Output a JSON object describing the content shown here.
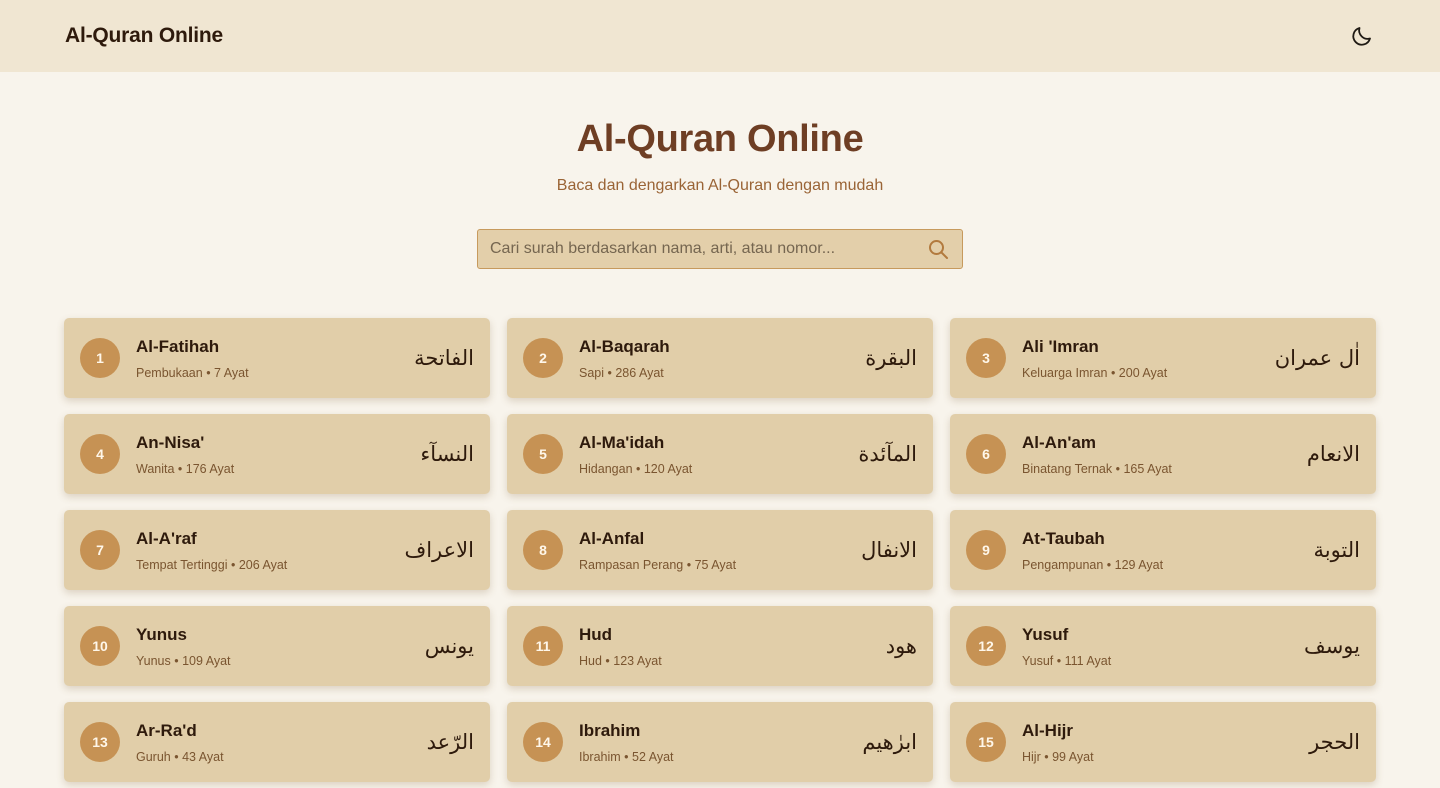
{
  "navbar": {
    "brand": "Al-Quran Online",
    "theme_icon": "moon-icon"
  },
  "hero": {
    "title": "Al-Quran Online",
    "subtitle": "Baca dan dengarkan Al-Quran dengan mudah"
  },
  "search": {
    "placeholder": "Cari surah berdasarkan nama, arti, atau nomor...",
    "value": "",
    "icon": "search-icon"
  },
  "colors": {
    "accent": "#c69254",
    "card": "#e1cea9",
    "title": "#6e3e24",
    "page": "#f8f4ec",
    "navbar": "#f0e6d2"
  },
  "surahs": [
    {
      "number": "1",
      "latin": "Al-Fatihah",
      "meaning": "Pembukaan",
      "ayat": "7 Ayat",
      "arabic": "الفاتحة"
    },
    {
      "number": "2",
      "latin": "Al-Baqarah",
      "meaning": "Sapi",
      "ayat": "286 Ayat",
      "arabic": "البقرة"
    },
    {
      "number": "3",
      "latin": "Ali 'Imran",
      "meaning": "Keluarga Imran",
      "ayat": "200 Ayat",
      "arabic": "اٰل عمران"
    },
    {
      "number": "4",
      "latin": "An-Nisa'",
      "meaning": "Wanita",
      "ayat": "176 Ayat",
      "arabic": "النسآء"
    },
    {
      "number": "5",
      "latin": "Al-Ma'idah",
      "meaning": "Hidangan",
      "ayat": "120 Ayat",
      "arabic": "المآئدة"
    },
    {
      "number": "6",
      "latin": "Al-An'am",
      "meaning": "Binatang Ternak",
      "ayat": "165 Ayat",
      "arabic": "الانعام"
    },
    {
      "number": "7",
      "latin": "Al-A'raf",
      "meaning": "Tempat Tertinggi",
      "ayat": "206 Ayat",
      "arabic": "الاعراف"
    },
    {
      "number": "8",
      "latin": "Al-Anfal",
      "meaning": "Rampasan Perang",
      "ayat": "75 Ayat",
      "arabic": "الانفال"
    },
    {
      "number": "9",
      "latin": "At-Taubah",
      "meaning": "Pengampunan",
      "ayat": "129 Ayat",
      "arabic": "التوبة"
    },
    {
      "number": "10",
      "latin": "Yunus",
      "meaning": "Yunus",
      "ayat": "109 Ayat",
      "arabic": "يونس"
    },
    {
      "number": "11",
      "latin": "Hud",
      "meaning": "Hud",
      "ayat": "123 Ayat",
      "arabic": "هود"
    },
    {
      "number": "12",
      "latin": "Yusuf",
      "meaning": "Yusuf",
      "ayat": "111 Ayat",
      "arabic": "يوسف"
    },
    {
      "number": "13",
      "latin": "Ar-Ra'd",
      "meaning": "Guruh",
      "ayat": "43 Ayat",
      "arabic": "الرّعد"
    },
    {
      "number": "14",
      "latin": "Ibrahim",
      "meaning": "Ibrahim",
      "ayat": "52 Ayat",
      "arabic": "ابرٰهيم"
    },
    {
      "number": "15",
      "latin": "Al-Hijr",
      "meaning": "Hijr",
      "ayat": "99 Ayat",
      "arabic": "الحجر"
    }
  ]
}
